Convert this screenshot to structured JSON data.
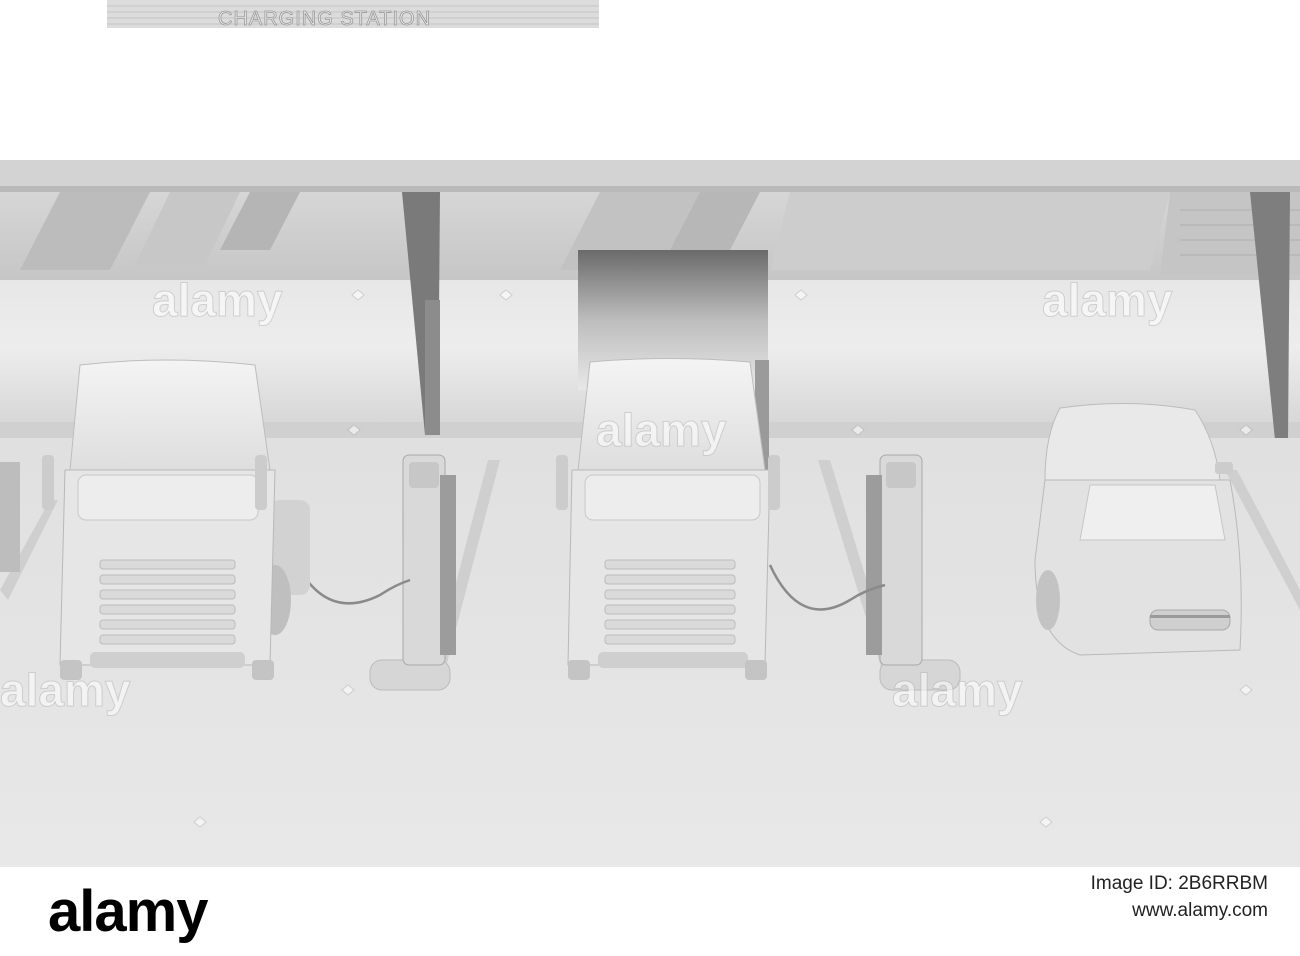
{
  "scene": {
    "sign_text": "CHARGING STATION",
    "watermark_text": "alamy",
    "colors": {
      "background": "#ffffff",
      "clay_light": "#ececec",
      "clay_mid": "#cfcfcf",
      "clay_dark": "#8f8f8f"
    }
  },
  "footer": {
    "logo": "alamy",
    "image_id": "Image ID: 2B6RRBM",
    "url": "www.alamy.com"
  }
}
